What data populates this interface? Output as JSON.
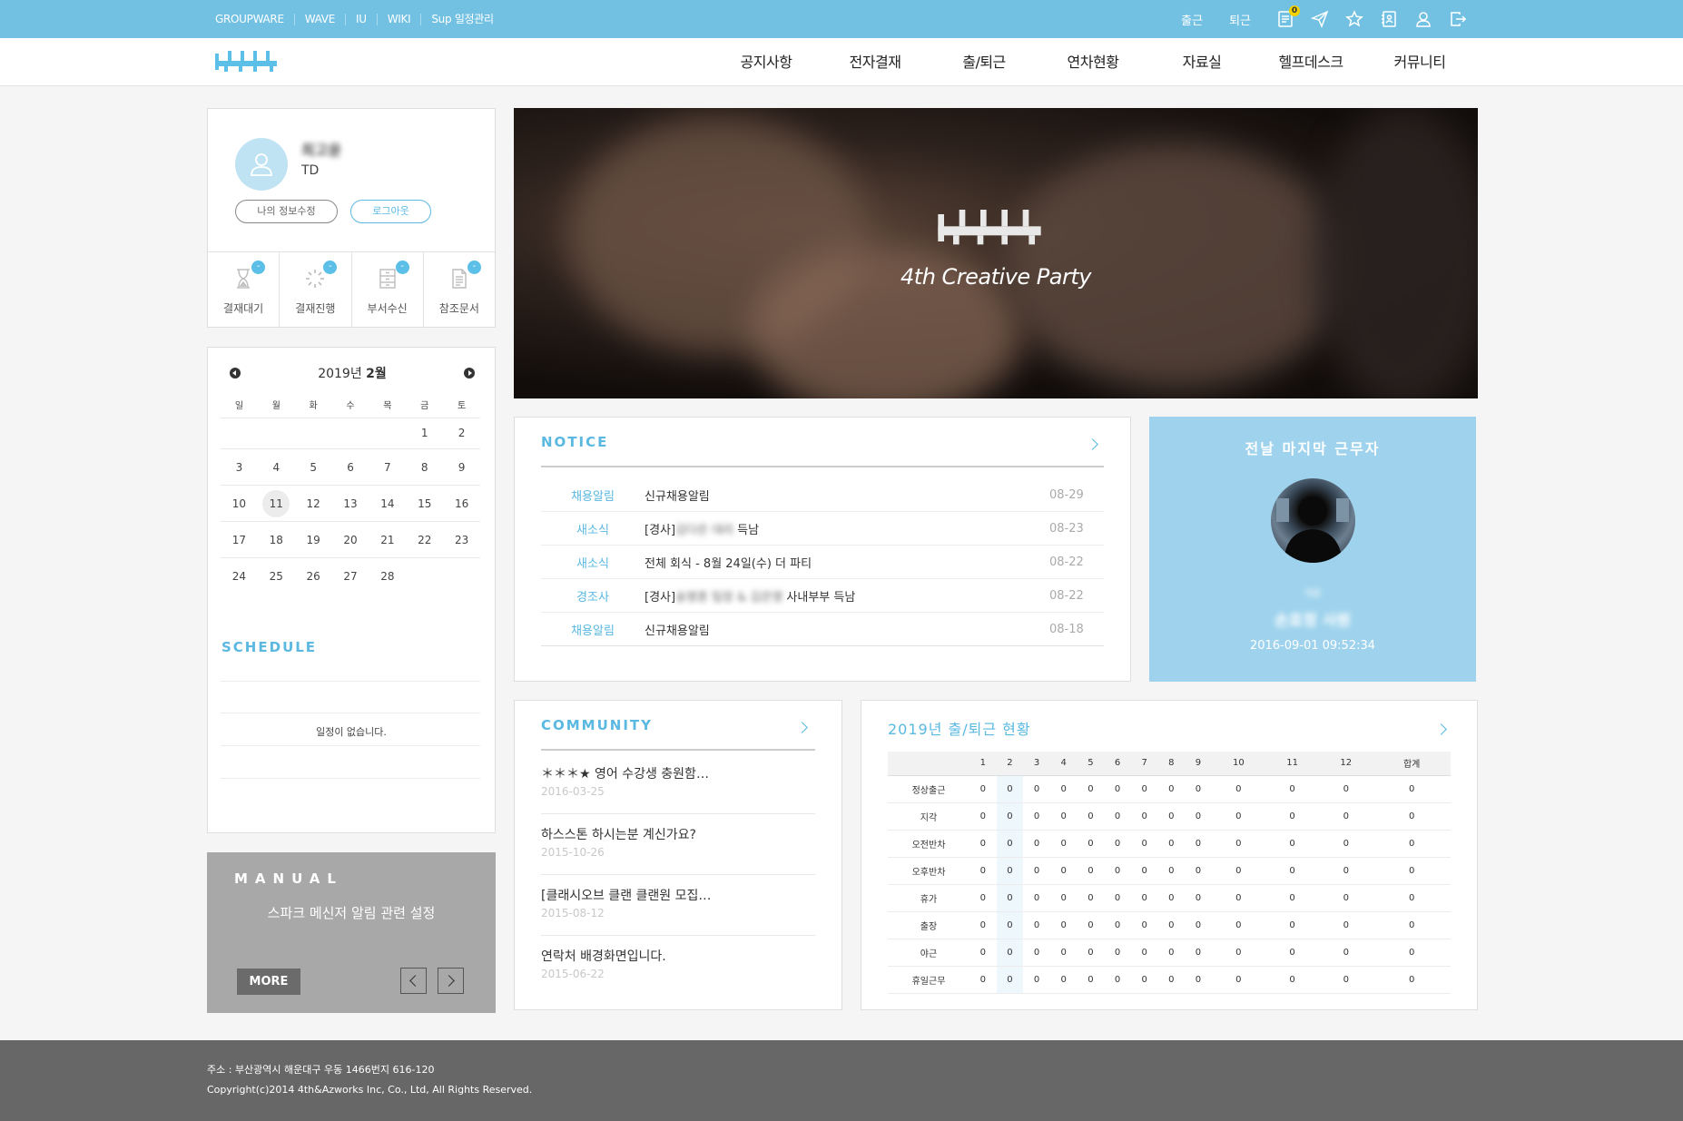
{
  "topbar": {
    "links": [
      "GROUPWARE",
      "WAVE",
      "IU",
      "WIKI",
      "Sup 일정관리"
    ],
    "checkin": "출근",
    "checkout": "퇴근",
    "notification_count": "0"
  },
  "nav": {
    "items": [
      "공지사항",
      "전자결재",
      "출/퇴근",
      "연차현황",
      "자료실",
      "헬프데스크",
      "커뮤니티"
    ]
  },
  "profile": {
    "name": "최고윤",
    "role": "TD",
    "edit_label": "나의 정보수정",
    "logout_label": "로그아웃",
    "approvals": [
      {
        "label": "결재대기",
        "count": "-"
      },
      {
        "label": "결재진행",
        "count": "-"
      },
      {
        "label": "부서수신",
        "count": "-"
      },
      {
        "label": "참조문서",
        "count": "-"
      }
    ]
  },
  "calendar": {
    "year_label": "2019년",
    "month_label": "2월",
    "weekdays": [
      "일",
      "월",
      "화",
      "수",
      "목",
      "금",
      "토"
    ],
    "weeks": [
      [
        "",
        "",
        "",
        "",
        "",
        "1",
        "2"
      ],
      [
        "3",
        "4",
        "5",
        "6",
        "7",
        "8",
        "9"
      ],
      [
        "10",
        "11",
        "12",
        "13",
        "14",
        "15",
        "16"
      ],
      [
        "17",
        "18",
        "19",
        "20",
        "21",
        "22",
        "23"
      ],
      [
        "24",
        "25",
        "26",
        "27",
        "28",
        "",
        ""
      ]
    ],
    "today": "11"
  },
  "schedule": {
    "title": "SCHEDULE",
    "empty": "일정이 없습니다."
  },
  "manual": {
    "title": "MANUAL",
    "desc": "스파크 메신저 알림 관련 설정",
    "more": "MORE"
  },
  "banner": {
    "tagline": "4th Creative Party"
  },
  "notice": {
    "title": "NOTICE",
    "items": [
      {
        "cat": "채용알림",
        "title": "신규채용알림",
        "blur": "",
        "tail": "",
        "date": "08-29"
      },
      {
        "cat": "새소식",
        "title": "[경사]",
        "blur": "김다은 대리",
        "tail": " 득남",
        "date": "08-23"
      },
      {
        "cat": "새소식",
        "title": "전체 회식 - 8월 24일(수) 더 파티",
        "blur": "",
        "tail": "",
        "date": "08-22"
      },
      {
        "cat": "경조사",
        "title": "[경사]",
        "blur": "송명훈 팀장 & 김은영",
        "tail": " 사내부부 득남",
        "date": "08-22"
      },
      {
        "cat": "채용알림",
        "title": "신규채용알림",
        "blur": "",
        "tail": "",
        "date": "08-18"
      }
    ]
  },
  "last_worker": {
    "title": "전날 마지막 근무자",
    "dept": "개발",
    "name": "손효정 사원",
    "datetime": "2016-09-01 09:52:34"
  },
  "community": {
    "title": "COMMUNITY",
    "items": [
      {
        "title": "＊＊＊★ 영어 수강생 충원함…",
        "date": "2016-03-25"
      },
      {
        "title": "하스스톤 하시는분 계신가요?",
        "date": "2015-10-26"
      },
      {
        "title": "[클래시오브 클랜 클랜원 모집…",
        "date": "2015-08-12"
      },
      {
        "title": "연락처 배경화면입니다.",
        "date": "2015-06-22"
      }
    ]
  },
  "attendance": {
    "title": "2019년 출/퇴근 현황",
    "columns": [
      "",
      "1",
      "2",
      "3",
      "4",
      "5",
      "6",
      "7",
      "8",
      "9",
      "10",
      "11",
      "12",
      "합계"
    ],
    "rows": [
      {
        "label": "정상출근",
        "values": [
          "0",
          "0",
          "0",
          "0",
          "0",
          "0",
          "0",
          "0",
          "0",
          "0",
          "0",
          "0",
          "0"
        ]
      },
      {
        "label": "지각",
        "values": [
          "0",
          "0",
          "0",
          "0",
          "0",
          "0",
          "0",
          "0",
          "0",
          "0",
          "0",
          "0",
          "0"
        ]
      },
      {
        "label": "오전반차",
        "values": [
          "0",
          "0",
          "0",
          "0",
          "0",
          "0",
          "0",
          "0",
          "0",
          "0",
          "0",
          "0",
          "0"
        ]
      },
      {
        "label": "오후반차",
        "values": [
          "0",
          "0",
          "0",
          "0",
          "0",
          "0",
          "0",
          "0",
          "0",
          "0",
          "0",
          "0",
          "0"
        ]
      },
      {
        "label": "휴가",
        "values": [
          "0",
          "0",
          "0",
          "0",
          "0",
          "0",
          "0",
          "0",
          "0",
          "0",
          "0",
          "0",
          "0"
        ]
      },
      {
        "label": "출장",
        "values": [
          "0",
          "0",
          "0",
          "0",
          "0",
          "0",
          "0",
          "0",
          "0",
          "0",
          "0",
          "0",
          "0"
        ]
      },
      {
        "label": "야근",
        "values": [
          "0",
          "0",
          "0",
          "0",
          "0",
          "0",
          "0",
          "0",
          "0",
          "0",
          "0",
          "0",
          "0"
        ]
      },
      {
        "label": "휴일근무",
        "values": [
          "0",
          "0",
          "0",
          "0",
          "0",
          "0",
          "0",
          "0",
          "0",
          "0",
          "0",
          "0",
          "0"
        ]
      }
    ],
    "highlight_column": "2"
  },
  "footer": {
    "address": "주소 : 부산광역시 해운대구 우동 1466번지 616-120",
    "copyright": "Copyright(c)2014 4th&Azworks Inc, Co., Ltd, All Rights Reserved."
  },
  "colors": {
    "accent": "#72c1e3",
    "accent_text": "#5ab8e1",
    "last_worker_bg": "#9fd3ed",
    "manual_bg": "#a8a8a8",
    "footer_bg": "#676767"
  }
}
